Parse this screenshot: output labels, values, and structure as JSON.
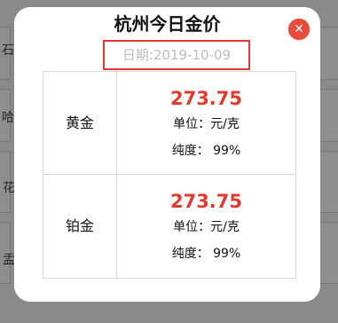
{
  "modal": {
    "title": "杭州今日金价",
    "date": "日期:2019-10-09",
    "close_icon": "close-icon",
    "close_symbol": "✕"
  },
  "prices": [
    {
      "metal": "黄金",
      "price": "273.75",
      "unit": "单位：元/克",
      "purity": "纯度：  99%"
    },
    {
      "metal": "铂金",
      "price": "273.75",
      "unit": "单位：元/克",
      "purity": "纯度：  99%"
    }
  ],
  "background": {
    "glyphs": [
      "石",
      "哈",
      "花",
      "盂"
    ]
  },
  "colors": {
    "accent_red": "#e33a2f",
    "date_border": "#e03b37",
    "date_text": "#bdbdbd"
  }
}
